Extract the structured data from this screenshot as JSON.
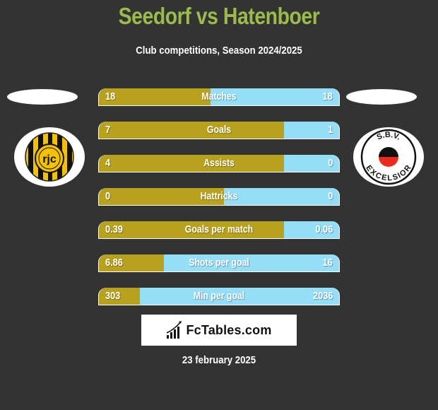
{
  "header": {
    "title": "Seedorf vs Hatenboer",
    "subtitle": "Club competitions, Season 2024/2025"
  },
  "teams": {
    "left": {
      "name": "Roda JC Kerkrade",
      "badge_text": "rjc",
      "icon": "roda-jc-badge-icon"
    },
    "right": {
      "name": "S.B.V. Excelsior",
      "badge_text_top": "S.B.V.",
      "badge_text_bottom": "EXCELSIOR",
      "icon": "excelsior-badge-icon"
    }
  },
  "colors": {
    "background": "#333333",
    "title": "#9dbb4a",
    "left_bar": "#b8a21d",
    "right_bar": "#95def7",
    "text": "#ffffff"
  },
  "stats": [
    {
      "label": "Matches",
      "left": "18",
      "right": "18",
      "left_share": 0.465
    },
    {
      "label": "Goals",
      "left": "7",
      "right": "1",
      "left_share": 0.77
    },
    {
      "label": "Assists",
      "left": "4",
      "right": "0",
      "left_share": 0.77
    },
    {
      "label": "Hattricks",
      "left": "0",
      "right": "0",
      "left_share": 0.52
    },
    {
      "label": "Goals per match",
      "left": "0.39",
      "right": "0.06",
      "left_share": 0.77
    },
    {
      "label": "Shots per goal",
      "left": "6.86",
      "right": "16",
      "left_share": 0.27
    },
    {
      "label": "Min per goal",
      "left": "303",
      "right": "2036",
      "left_share": 0.17
    }
  ],
  "brand": {
    "name": "FcTables.com",
    "icon": "bar-chart-icon"
  },
  "footer": {
    "date": "23 february 2025"
  }
}
